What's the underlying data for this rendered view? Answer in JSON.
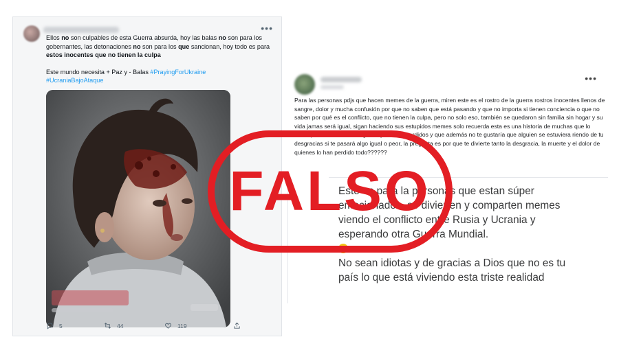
{
  "tweet": {
    "text_parts": {
      "p1": "Ellos ",
      "p2": "no",
      "p3": " son culpables de esta Guerra absurda, hoy las balas ",
      "p4": "no",
      "p5": " son para los gobernantes, las detonaciones ",
      "p6": "no",
      "p7": " son para los ",
      "p8": "que",
      "p9": " sancionan, hoy todo es para ",
      "p10": "estos inocentes que no tienen la culpa"
    },
    "line2": "Este mundo necesita + Paz y - Balas ",
    "hashtag1": "#PrayingForUkraine",
    "hashtag2": "#UcraniaBajoAtaque",
    "more_label": "•••",
    "replies": "5",
    "retweets": "44",
    "likes": "119"
  },
  "post": {
    "more_label": "•••",
    "text": "Para las personas pdjs que hacen memes de la guerra, miren este es el rostro de la guerra rostros inocentes llenos de sangre, dolor y mucha confusión por que no saben que está pasando y que no importa si tienen conciencia o que no saben por qué es el conflicto, que no tienen la culpa, pero no solo eso, también se quedaron sin familia sin hogar y su vida jamas será igual, sigan haciendo sus estupidos memes solo recuerda esta es una historia de muchas que lo están perdiendo todo, imágenes y sueños perdidos y que además no te gustaría que alguien se estuviera riendo de tu desgracias si te pasará algo igual o peor, la pregunta es por que te divierte tanto la desgracia, la muerte y el dolor de quienes lo han perdido todo??????",
    "comment1": "Esto es para la personas que estan súper emocionados, se divierten y comparten memes viendo el conflicto entre Rusia y Ucrania y esperando otra Guerra Mundial.",
    "comment2": "No sean idiotas y de gracias a Dios que no es tu país lo que está viviendo esta triste realidad"
  },
  "stamp": {
    "label": "FALSO",
    "color": "#e31e24"
  },
  "colors": {
    "link": "#1d9bf0",
    "muted": "#536471"
  }
}
